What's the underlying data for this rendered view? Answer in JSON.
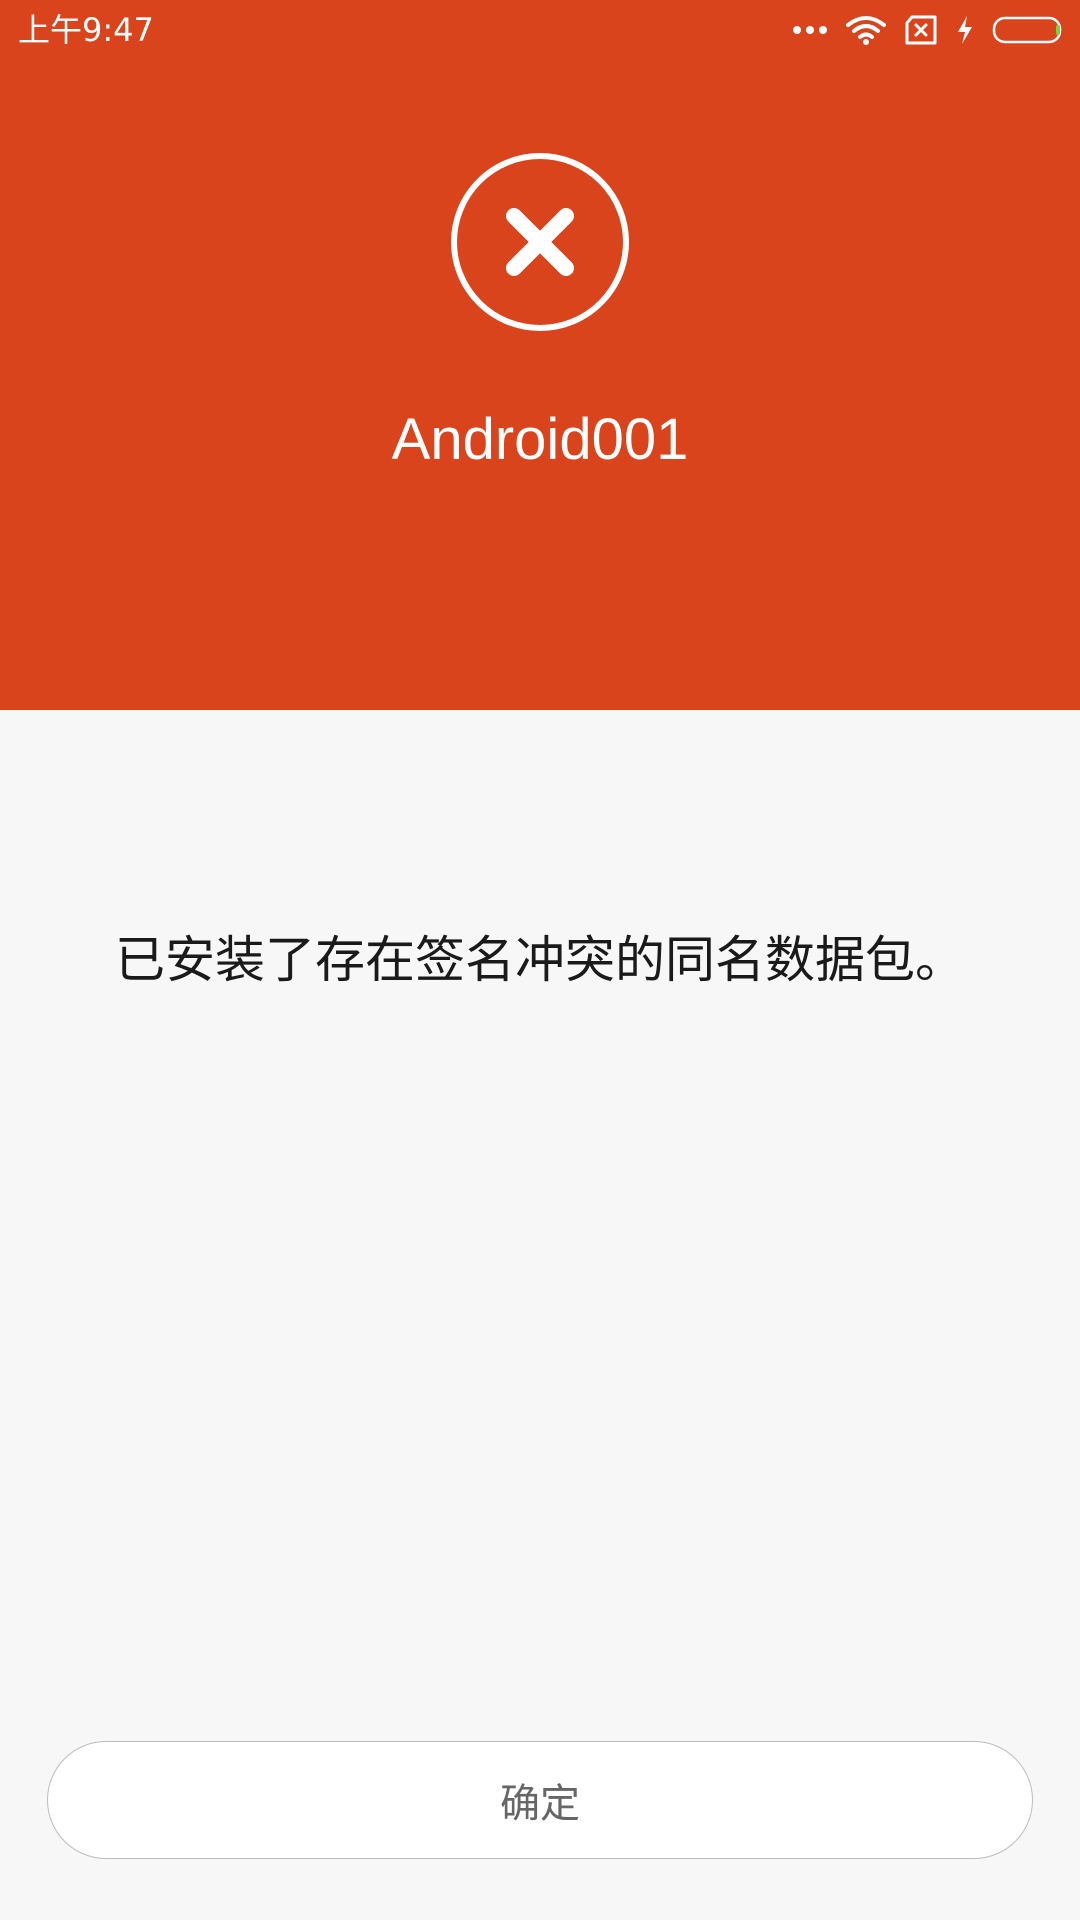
{
  "status_bar": {
    "time": "上午9:47",
    "icons": [
      "more-dots-icon",
      "wifi-icon",
      "no-sim-icon",
      "charging-bolt-icon",
      "battery-icon"
    ]
  },
  "header": {
    "status_icon": "error-circle-x-icon",
    "app_name": "Android001",
    "background_color": "#d9441c"
  },
  "content": {
    "message": "已安装了存在签名冲突的同名数据包。"
  },
  "footer": {
    "confirm_label": "确定"
  }
}
